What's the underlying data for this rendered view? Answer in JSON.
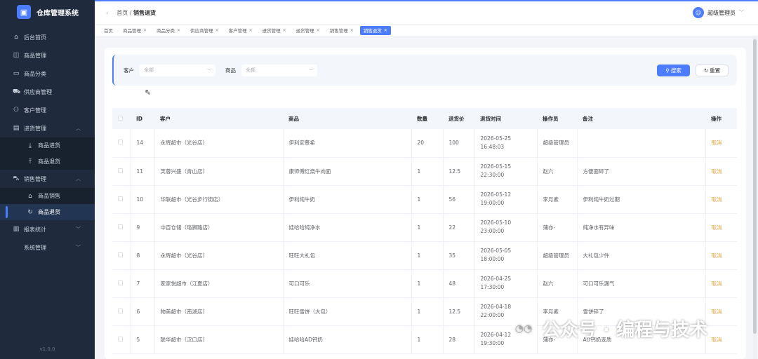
{
  "app": {
    "title": "仓库管理系统",
    "version": "v1.0.0"
  },
  "sidebar": {
    "items": [
      {
        "label": "后台首页",
        "icon": "home-icon"
      },
      {
        "label": "商品管理",
        "icon": "bag-icon"
      },
      {
        "label": "商品分类",
        "icon": "folder-icon"
      },
      {
        "label": "供应商管理",
        "icon": "truck-icon"
      },
      {
        "label": "客户管理",
        "icon": "user-icon"
      },
      {
        "label": "进货管理",
        "icon": "box-icon"
      },
      {
        "label": "商品进货",
        "icon": "download-icon"
      },
      {
        "label": "商品退货",
        "icon": "upload-icon"
      },
      {
        "label": "销售管理",
        "icon": "cart-icon"
      },
      {
        "label": "商品销售",
        "icon": "shop-icon"
      },
      {
        "label": "商品退货",
        "icon": "refresh-icon"
      },
      {
        "label": "报表统计",
        "icon": "chart-icon"
      },
      {
        "label": "系统管理",
        "icon": "gear-icon"
      }
    ]
  },
  "header": {
    "breadcrumb_home": "首页",
    "breadcrumb_sep": "/",
    "breadcrumb_current": "销售退货",
    "user_name": "超级管理员"
  },
  "tabs": [
    {
      "label": "首页",
      "closable": false
    },
    {
      "label": "商品管理",
      "closable": true
    },
    {
      "label": "商品分类",
      "closable": true
    },
    {
      "label": "供应商管理",
      "closable": true
    },
    {
      "label": "客户管理",
      "closable": true
    },
    {
      "label": "进货管理",
      "closable": true
    },
    {
      "label": "退货管理",
      "closable": true
    },
    {
      "label": "销售管理",
      "closable": true
    },
    {
      "label": "销售退货",
      "closable": true,
      "active": true
    }
  ],
  "filter": {
    "customer_label": "客户",
    "customer_placeholder": "全部",
    "product_label": "商品",
    "product_placeholder": "全部",
    "search_label": "搜索",
    "reset_label": "重置"
  },
  "table": {
    "columns": [
      "ID",
      "客户",
      "商品",
      "数量",
      "退货价",
      "退货时间",
      "操作员",
      "备注",
      "操作"
    ],
    "action_label": "取消",
    "rows": [
      {
        "id": "14",
        "customer": "永辉超市（光谷店）",
        "product": "伊利安慕希",
        "qty": "20",
        "price": "100",
        "date": "2026-05-25",
        "time": "16:48:03",
        "operator": "超级管理员",
        "remark": ""
      },
      {
        "id": "11",
        "customer": "芙蓉兴盛（青山店）",
        "product": "康师傅红烧牛肉面",
        "qty": "1",
        "price": "12.5",
        "date": "2026-05-15",
        "time": "22:30:00",
        "operator": "赵六",
        "remark": "方便面碎了"
      },
      {
        "id": "10",
        "customer": "华联超市（光谷步行街店）",
        "product": "伊利纯牛奶",
        "qty": "1",
        "price": "56",
        "date": "2026-05-12",
        "time": "19:00:00",
        "operator": "李月素",
        "remark": "伊利纯牛奶过期"
      },
      {
        "id": "9",
        "customer": "中百仓储（珞狮路店）",
        "product": "娃哈哈纯净水",
        "qty": "1",
        "price": "22",
        "date": "2026-05-10",
        "time": "23:00:00",
        "operator": "蒲亦-",
        "remark": "纯净水有异味"
      },
      {
        "id": "8",
        "customer": "永辉超市（光谷店）",
        "product": "旺旺大礼包",
        "qty": "1",
        "price": "35",
        "date": "2026-05-05",
        "time": "18:00:00",
        "operator": "超级管理员",
        "remark": "大礼包少件"
      },
      {
        "id": "7",
        "customer": "家家悦超市（江夏店）",
        "product": "可口可乐",
        "qty": "1",
        "price": "48",
        "date": "2026-04-25",
        "time": "17:30:00",
        "operator": "赵六",
        "remark": "可口可乐漏气"
      },
      {
        "id": "6",
        "customer": "物美超市（南湖店）",
        "product": "旺旺雪饼（大包）",
        "qty": "1",
        "price": "12.5",
        "date": "2026-04-18",
        "time": "22:00:00",
        "operator": "李月素",
        "remark": "雪饼碎了"
      },
      {
        "id": "5",
        "customer": "联华超市（汉口店）",
        "product": "娃哈哈AD钙奶",
        "qty": "1",
        "price": "28",
        "date": "2026-04-12",
        "time": "19:30:00",
        "operator": "蒲亦-",
        "remark": "AD钙奶变质"
      }
    ]
  },
  "watermark": {
    "text": "公众号 · 编程与技术"
  },
  "colors": {
    "primary": "#4d7dff",
    "sidebar_bg": "#1f2b3d",
    "warning": "#e6a23c"
  }
}
